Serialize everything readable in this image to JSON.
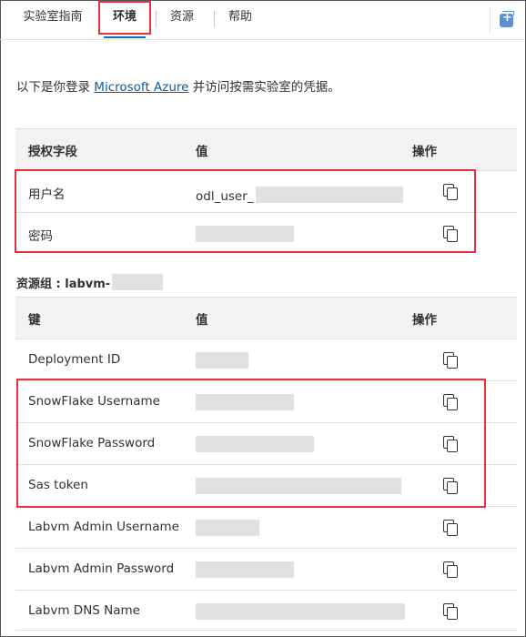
{
  "tabs": [
    {
      "label": "实验室指南",
      "active": false
    },
    {
      "label": "环境",
      "active": true
    },
    {
      "label": "资源",
      "active": false
    },
    {
      "label": "帮助",
      "active": false
    }
  ],
  "intro": {
    "prefix": "以下是你登录 ",
    "link": "Microsoft Azure",
    "suffix": " 并访问按需实验室的凭据。"
  },
  "credentials": {
    "headers": {
      "field": "授权字段",
      "value": "值",
      "action": "操作"
    },
    "rows": [
      {
        "label": "用户名",
        "value": "odl_user_"
      },
      {
        "label": "密码",
        "value": ""
      }
    ]
  },
  "resource_group": {
    "title": "资源组 : labvm-",
    "headers": {
      "key": "键",
      "value": "值",
      "action": "操作"
    },
    "rows": [
      {
        "label": "Deployment ID"
      },
      {
        "label": "SnowFlake Username"
      },
      {
        "label": "SnowFlake Password"
      },
      {
        "label": "Sas token"
      },
      {
        "label": "Labvm Admin Username"
      },
      {
        "label": "Labvm Admin Password"
      },
      {
        "label": "Labvm DNS Name"
      }
    ]
  },
  "icons": {
    "copy": "copy-icon",
    "add_panel": "add-panel-icon"
  },
  "colors": {
    "highlight": "#e5313b",
    "link": "#0f5c99",
    "active_tab_underline": "#0f6cbd"
  }
}
